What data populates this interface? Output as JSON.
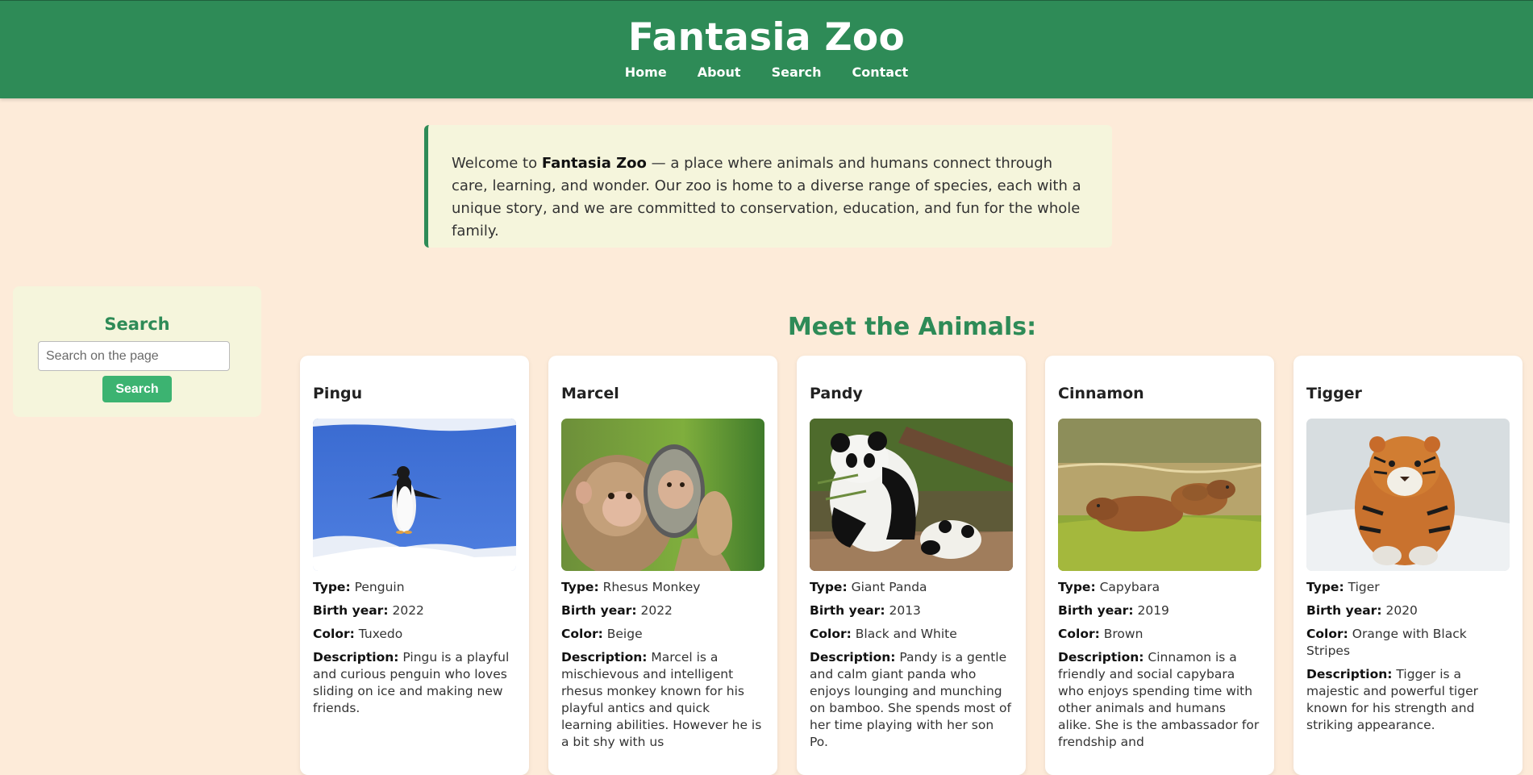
{
  "header": {
    "title": "Fantasia Zoo",
    "nav": [
      "Home",
      "About",
      "Search",
      "Contact"
    ]
  },
  "intro": {
    "prefix": "Welcome to ",
    "brand": "Fantasia Zoo",
    "suffix": " — a place where animals and humans connect through care, learning, and wonder. Our zoo is home to a diverse range of species, each with a unique story, and we are committed to conservation, education, and fun for the whole family."
  },
  "sidebar": {
    "heading": "Search",
    "placeholder": "Search on the page",
    "button": "Search"
  },
  "animals_title": "Meet the Animals:",
  "labels": {
    "type": "Type:",
    "birth": "Birth year:",
    "color": "Color:",
    "description": "Description:"
  },
  "animals": [
    {
      "name": "Pingu",
      "type": "Penguin",
      "birth_year": "2022",
      "color": "Tuxedo",
      "description": "Pingu is a playful and curious penguin who loves sliding on ice and making new friends.",
      "image": "penguin-photo"
    },
    {
      "name": "Marcel",
      "type": "Rhesus Monkey",
      "birth_year": "2022",
      "color": "Beige",
      "description": "Marcel is a mischievous and intelligent rhesus monkey known for his playful antics and quick learning abilities. However he is a bit shy with us",
      "image": "monkey-photo"
    },
    {
      "name": "Pandy",
      "type": "Giant Panda",
      "birth_year": "2013",
      "color": "Black and White",
      "description": "Pandy is a gentle and calm giant panda who enjoys lounging and munching on bamboo. She spends most of her time playing with her son Po.",
      "image": "panda-photo"
    },
    {
      "name": "Cinnamon",
      "type": "Capybara",
      "birth_year": "2019",
      "color": "Brown",
      "description": "Cinnamon is a friendly and social capybara who enjoys spending time with other animals and humans alike. She is the ambassador for frendship and",
      "image": "capybara-photo"
    },
    {
      "name": "Tigger",
      "type": "Tiger",
      "birth_year": "2020",
      "color": "Orange with Black Stripes",
      "description": "Tigger is a majestic and powerful tiger known for his strength and striking appearance.",
      "image": "tiger-photo"
    }
  ]
}
